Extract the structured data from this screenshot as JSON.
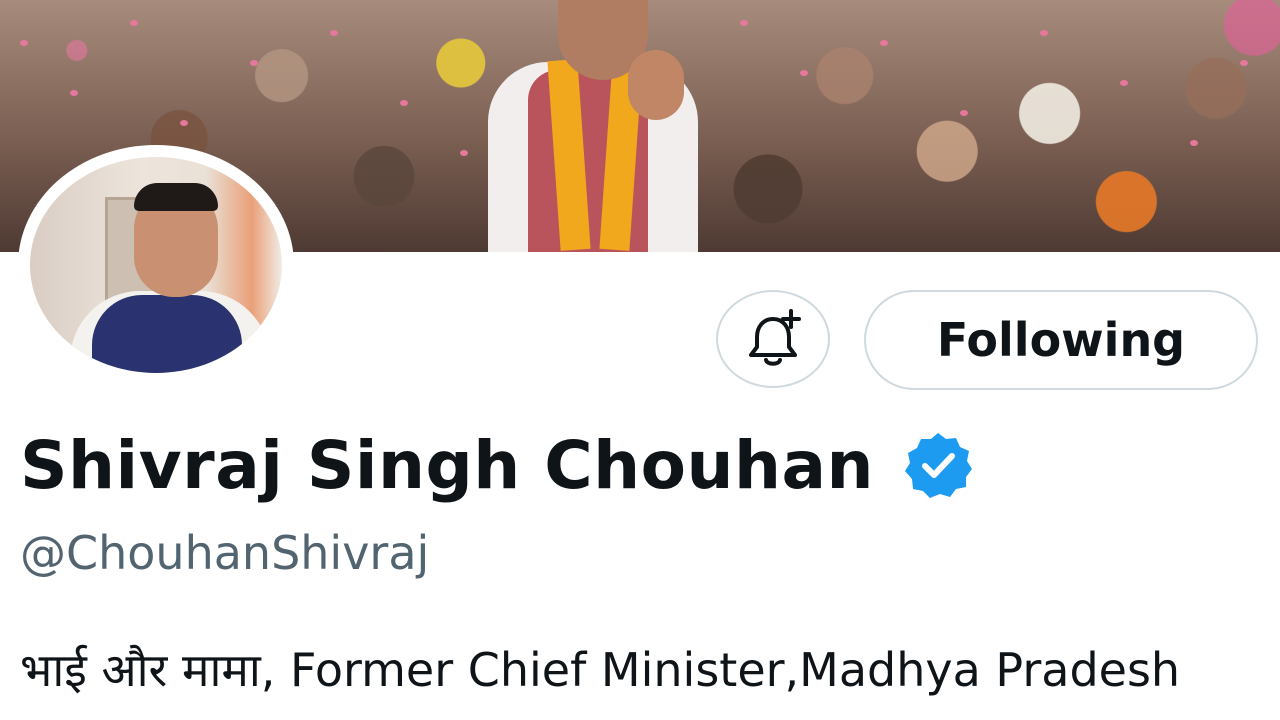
{
  "profile": {
    "display_name": "Shivraj Singh Chouhan",
    "handle": "@ChouhanShivraj",
    "bio": "भाई और मामा, Former Chief Minister,Madhya Pradesh"
  },
  "actions": {
    "notify_icon": "bell-plus-icon",
    "following_label": "Following"
  },
  "icons": {
    "verified": "verified-badge-icon"
  },
  "colors": {
    "verified_blue": "#1d9bf0",
    "button_border": "#cfd9de",
    "text_primary": "#0f1419",
    "text_secondary": "#536471"
  }
}
